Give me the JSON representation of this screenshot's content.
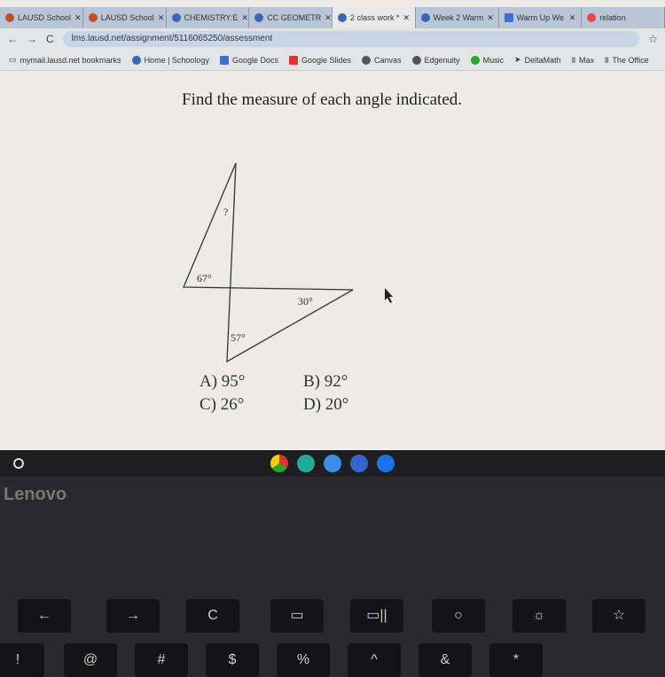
{
  "browser": {
    "tabs": [
      {
        "label": "LAUSD School"
      },
      {
        "label": "LAUSD School"
      },
      {
        "label": "CHEMISTRY:E"
      },
      {
        "label": "CC GEOMETR"
      },
      {
        "label": "2 class work *",
        "active": true
      },
      {
        "label": "Week 2 Warm"
      },
      {
        "label": "Warm Up We"
      },
      {
        "label": "relation"
      }
    ],
    "url": "lms.lausd.net/assignment/5116065250/assessment",
    "bookmarks": [
      "mymail.lausd.net bookmarks",
      "Home | Schoology",
      "Google Docs",
      "Google Slides",
      "Canvas",
      "Edgenuity",
      "Music",
      "DeltaMath",
      "Max",
      "The Office"
    ]
  },
  "question": {
    "prompt": "Find the measure of each angle indicated.",
    "angles": {
      "unknown": "?",
      "top_left": "67°",
      "right": "30°",
      "bottom": "57°"
    },
    "choices": [
      {
        "label": "A)  95°"
      },
      {
        "label": "B)  92°"
      },
      {
        "label": "C)  26°"
      },
      {
        "label": "D)  20°"
      }
    ]
  },
  "laptop": {
    "brand": "Lenovo",
    "keys": [
      "←",
      "→",
      "C",
      "▭",
      "▭||",
      "○",
      "☼",
      "☆",
      "!",
      "@",
      "#",
      "$",
      "%",
      "^",
      "&",
      "*"
    ]
  }
}
